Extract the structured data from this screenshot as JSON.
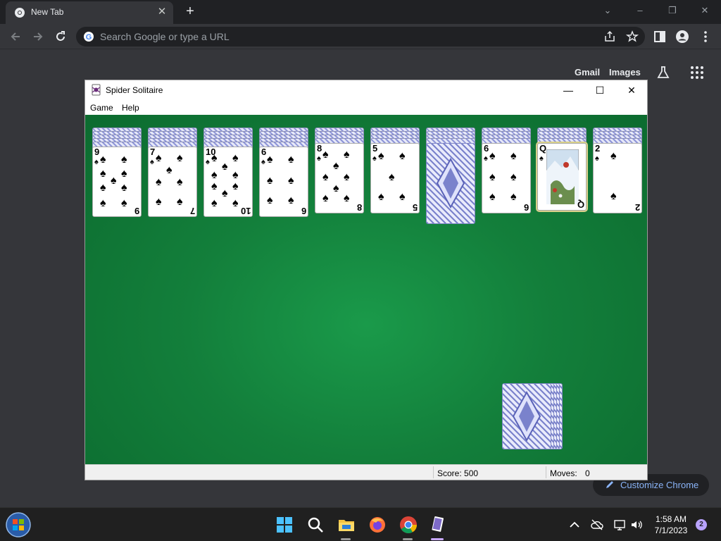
{
  "browser": {
    "tab_title": "New Tab",
    "omnibox_placeholder": "Search Google or type a URL",
    "ntp_links": [
      "Gmail",
      "Images"
    ],
    "customize_label": "Customize Chrome"
  },
  "spider": {
    "title": "Spider Solitaire",
    "menu": [
      "Game",
      "Help"
    ],
    "score": "Score: 500",
    "moves_label": "Moves:",
    "moves_value": "0",
    "columns": [
      {
        "rank": "9",
        "hidden": 5
      },
      {
        "rank": "7",
        "hidden": 5
      },
      {
        "rank": "10",
        "hidden": 5
      },
      {
        "rank": "6",
        "hidden": 5
      },
      {
        "rank": "8",
        "hidden": 4
      },
      {
        "rank": "5",
        "hidden": 4
      },
      {
        "rank": "",
        "hidden": 4
      },
      {
        "rank": "6",
        "hidden": 4
      },
      {
        "rank": "Q",
        "hidden": 4
      },
      {
        "rank": "2",
        "hidden": 4
      }
    ],
    "suit": "♠",
    "stock_piles": 5
  },
  "taskbar": {
    "time": "1:58 AM",
    "date": "7/1/2023",
    "notifications": "2"
  }
}
